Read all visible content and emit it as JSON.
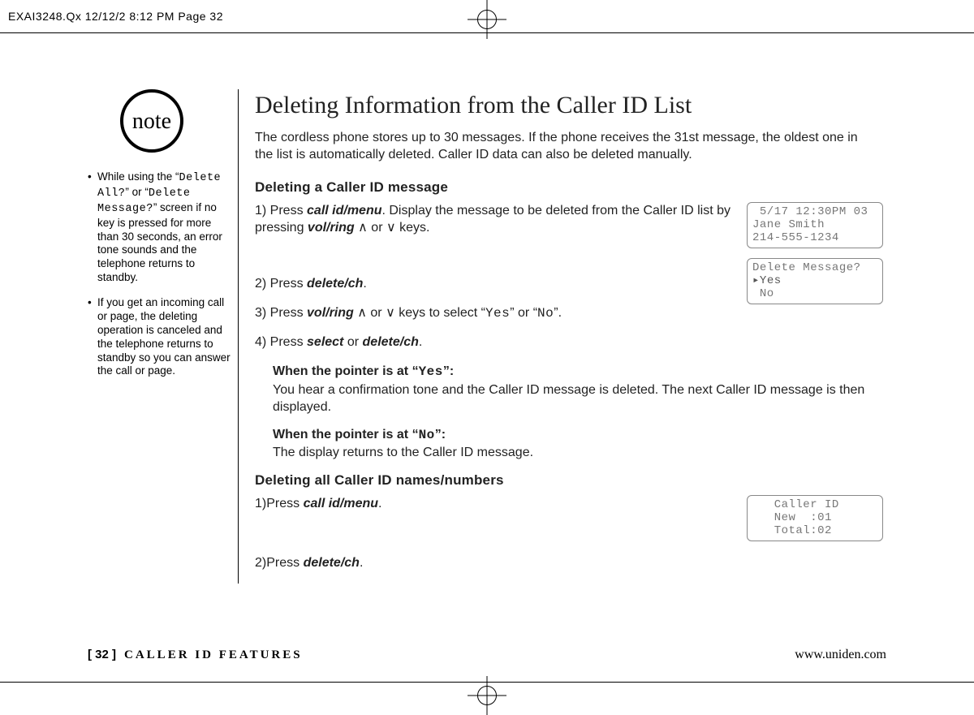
{
  "header_line": "EXAI3248.Qx  12/12/2 8:12 PM  Page 32",
  "note_badge": "note",
  "sidebar": {
    "bullets": [
      {
        "pre": "While using the “",
        "lcd1": "Delete All?",
        "mid": "” or “",
        "lcd2": "Delete Message?",
        "post": "” screen if no key is pressed for more than 30 seconds, an error tone sounds and the telephone returns to standby."
      },
      {
        "text": "If you get an incoming call or page, the deleting operation is canceled and the telephone returns to standby so you can answer the call or page."
      }
    ]
  },
  "title": "Deleting Information from the Caller ID List",
  "intro": "The cordless phone stores up to 30 messages. If the phone receives the 31st message, the oldest one in the list is automatically deleted. Caller ID data can also be deleted manually.",
  "section1": {
    "heading": "Deleting a Caller ID message",
    "step1": {
      "num": "1) ",
      "a": "Press ",
      "btn1": "call id/menu",
      "b": ". Display the message to be deleted from the Caller ID list by pressing ",
      "btn2": "vol/ring",
      "c": " ∧ or ∨ keys."
    },
    "step2": {
      "num": "2) ",
      "a": "Press ",
      "btn": "delete/ch",
      "b": "."
    },
    "step3": {
      "num": "3) ",
      "a": "Press ",
      "btn": "vol/ring",
      "b": " ∧ or ∨ keys to select “",
      "lcd1": "Yes",
      "c": "” or “",
      "lcd2": "No",
      "d": "”."
    },
    "step4": {
      "num": "4) ",
      "a": "Press ",
      "btn1": "select",
      "b": " or ",
      "btn2": "delete/ch",
      "c": "."
    },
    "yes_block": {
      "lead_a": "When the pointer is at “",
      "lead_lcd": "Yes",
      "lead_b": "”:",
      "body": "You hear a confirmation tone and the Caller ID message is deleted. The next Caller ID message is then displayed."
    },
    "no_block": {
      "lead_a": "When the pointer is at “",
      "lead_lcd": "No",
      "lead_b": "”:",
      "body": "The display returns to the Caller ID message."
    },
    "lcd1": {
      "l1": " 5/17 12:30PM 03",
      "l2": "Jane Smith",
      "l3": "214-555-1234"
    },
    "lcd2": {
      "l1": "Delete Message?",
      "l2": "▸Yes",
      "l3": " No"
    }
  },
  "section2": {
    "heading": "Deleting all Caller ID names/numbers",
    "step1": {
      "num": "1)",
      "a": "Press ",
      "btn": "call id/menu",
      "b": "."
    },
    "step2": {
      "num": "2)",
      "a": "Press ",
      "btn": "delete/ch",
      "b": "."
    },
    "lcd": {
      "l1": "   Caller ID",
      "l2": "   New  :01",
      "l3": "   Total:02"
    }
  },
  "footer": {
    "page": "[ 32 ]",
    "section": "CALLER ID FEATURES",
    "url": "www.uniden.com"
  }
}
